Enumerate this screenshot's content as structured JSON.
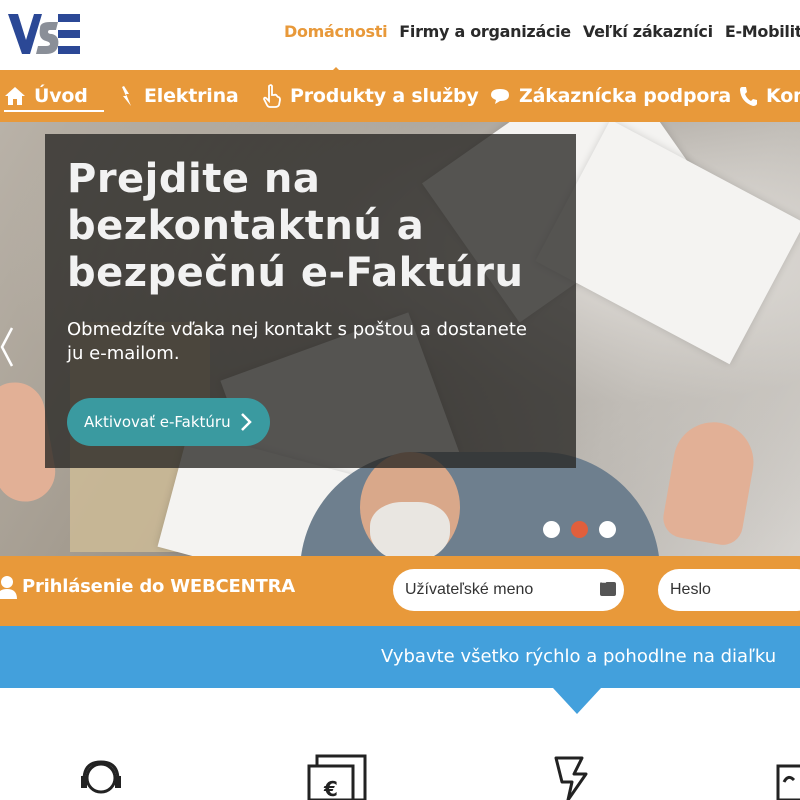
{
  "brand": {
    "logo": "VSE",
    "colors": {
      "orange": "#e8993a",
      "blue": "#43a0dc",
      "teal": "#3a9aa0",
      "navy": "#2b4896",
      "dot_active": "#e15f3c"
    }
  },
  "segments": [
    {
      "label": "Domácnosti",
      "active": true
    },
    {
      "label": "Firmy a organizácie",
      "active": false
    },
    {
      "label": "Veľkí zákazníci",
      "active": false
    },
    {
      "label": "E-Mobility",
      "active": false
    }
  ],
  "mainnav": [
    {
      "label": "Úvod",
      "icon": "home-icon",
      "active": true
    },
    {
      "label": "Elektrina",
      "icon": "lightning-icon",
      "active": false
    },
    {
      "label": "Produkty a služby",
      "icon": "hand-pointer-icon",
      "active": false
    },
    {
      "label": "Zákaznícka podpora",
      "icon": "chat-bubble-icon",
      "active": false
    },
    {
      "label": "Kon",
      "icon": "phone-icon",
      "active": false
    }
  ],
  "hero": {
    "headline": "Prejdite na bezkontaktnú a bezpečnú e-Faktúru",
    "subtext": "Obmedzíte vďaka nej kontakt s poštou a dostanete ju e-mailom.",
    "cta": "Aktivovať e-Faktúru",
    "slides": 3,
    "active_slide": 2
  },
  "login": {
    "title": "Prihlásenie do WEBCENTRA",
    "username_placeholder": "Užívateľské meno",
    "password_placeholder": "Heslo"
  },
  "banner": {
    "text": "Vybavte všetko rýchlo a pohodlne na diaľku"
  },
  "bottom_icons": [
    "headset-user-icon",
    "euro-invoice-icon",
    "lightning-outline-icon",
    "document-icon"
  ]
}
